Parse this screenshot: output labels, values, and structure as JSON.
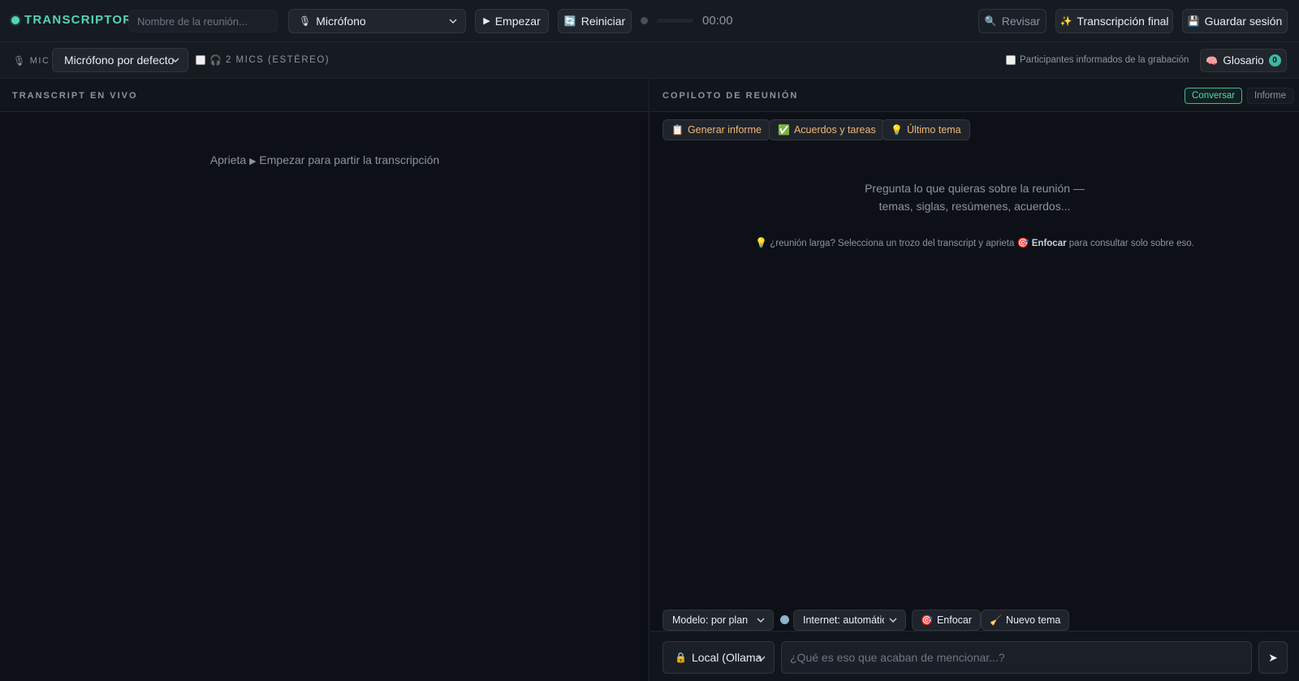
{
  "app": {
    "brand": "TRANSCRIPTOR",
    "accent": "#56d4b4"
  },
  "topbar": {
    "meeting_name_placeholder": "Nombre de la reunión...",
    "source_select": "Micrófono",
    "start_label": "Empezar",
    "reset_label": "Reiniciar",
    "timer": "00:00",
    "review_label": "Revisar",
    "final_transcript_label": "Transcripción final",
    "save_session_label": "Guardar sesión"
  },
  "subbar": {
    "mic_label": "MIC",
    "mic_select": "Micrófono por defecto",
    "stereo_label": "2 MICS (ESTÉREO)",
    "participants_label": "Participantes informados de la grabación",
    "glossary_label": "Glosario",
    "glossary_count": "0"
  },
  "left_panel": {
    "title": "TRANSCRIPT EN VIVO",
    "empty_prefix": "Aprieta",
    "empty_suffix": "Empezar para partir la transcripción"
  },
  "right_panel": {
    "title": "COPILOTO DE REUNIÓN",
    "tabs": [
      {
        "label": "Conversar",
        "active": true
      },
      {
        "label": "Informe",
        "active": false
      }
    ],
    "quick_actions": [
      {
        "label": "Generar informe",
        "icon": "clipboard-icon"
      },
      {
        "label": "Acuerdos y tareas",
        "icon": "check-icon"
      },
      {
        "label": "Último tema",
        "icon": "lightbulb-icon"
      }
    ],
    "prompt_line1": "Pregunta lo que quieras sobre la reunión —",
    "prompt_line2": "temas, siglas, resúmenes, acuerdos...",
    "hint_prefix": "¿reunión larga? Selecciona un trozo del transcript y aprieta",
    "hint_bold": "Enfocar",
    "hint_suffix": "para consultar solo sobre eso.",
    "model_select": "Modelo: por plan",
    "internet_select": "Internet: automático",
    "focus_label": "Enfocar",
    "new_topic_label": "Nuevo tema",
    "provider_select": "Local (Ollama",
    "chat_placeholder": "¿Qué es eso que acaban de mencionar...?"
  }
}
